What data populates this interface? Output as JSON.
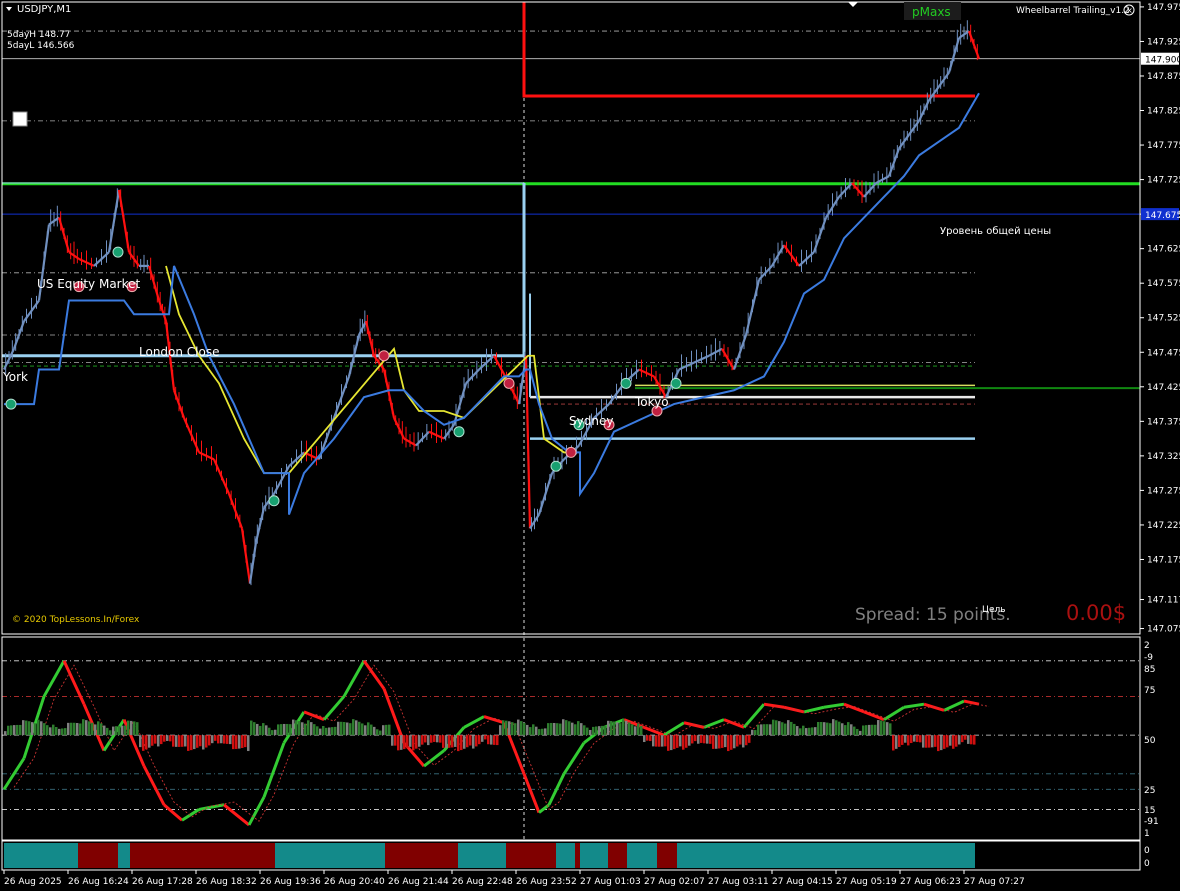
{
  "symbol": "USDJPY,M1",
  "info": {
    "five_day_high": "5dayH 148.77",
    "five_day_low": "5dayL 146.566"
  },
  "indicator_name": "Wheelbarrel Trailing_v1.2",
  "pmaxs_label": "pMaxs",
  "copyright": "© 2020 TopLessons.In/Forex",
  "spread_text": "Spread: 15 points.",
  "profit_text": "0.00$",
  "target_label": "Цель",
  "common_price_label": "Уровень общей цены",
  "sessions": {
    "us_equity": "US Equity Market",
    "london_close": "London Close",
    "new_york": "York",
    "sydney": "Sydney",
    "tokyo": "Tokyo"
  },
  "price_axis": {
    "ticks": [
      "147.975",
      "147.925",
      "147.875",
      "147.825",
      "147.775",
      "147.725",
      "147.675",
      "147.625",
      "147.575",
      "147.525",
      "147.475",
      "147.425",
      "147.375",
      "147.325",
      "147.275",
      "147.225",
      "147.175",
      "147.117",
      "147.075"
    ],
    "current_price_label": "147.900",
    "common_price_tag": "147.675"
  },
  "oscillator_axis": {
    "labels": [
      "2",
      "-9",
      "85",
      "75",
      "50",
      "25",
      "15",
      "-91",
      "1"
    ]
  },
  "bar_axis": {
    "labels": [
      "0",
      "0"
    ]
  },
  "time_axis": [
    "26 Aug 2025",
    "26 Aug 16:24",
    "26 Aug 17:28",
    "26 Aug 18:32",
    "26 Aug 19:36",
    "26 Aug 20:40",
    "26 Aug 21:44",
    "26 Aug 22:48",
    "26 Aug 23:52",
    "27 Aug 01:03",
    "27 Aug 02:07",
    "27 Aug 03:11",
    "27 Aug 04:15",
    "27 Aug 05:19",
    "27 Aug 06:23",
    "27 Aug 07:27"
  ],
  "colors": {
    "bull": "#7090c0",
    "bear": "#ff1010",
    "trail_line": "#3b7be0",
    "yellow": "#e6e632",
    "green_level": "#22dd22",
    "red_level": "#ff1010",
    "session_line": "#9ad0f0",
    "teal": "#138a8a",
    "maroon": "#800000"
  },
  "chart_data": {
    "type": "line",
    "x_categories": [
      "26 Aug 2025",
      "26 Aug 16:24",
      "26 Aug 17:28",
      "26 Aug 18:32",
      "26 Aug 19:36",
      "26 Aug 20:40",
      "26 Aug 21:44",
      "26 Aug 22:48",
      "26 Aug 23:52",
      "27 Aug 01:03",
      "27 Aug 02:07",
      "27 Aug 03:11",
      "27 Aug 04:15",
      "27 Aug 05:19",
      "27 Aug 06:23",
      "27 Aug 07:27"
    ],
    "ylim": [
      147.07,
      147.985
    ],
    "price": [
      [
        0,
        147.45
      ],
      [
        10,
        147.48
      ],
      [
        20,
        147.52
      ],
      [
        35,
        147.55
      ],
      [
        45,
        147.66
      ],
      [
        55,
        147.67
      ],
      [
        65,
        147.62
      ],
      [
        75,
        147.61
      ],
      [
        90,
        147.6
      ],
      [
        105,
        147.62
      ],
      [
        115,
        147.71
      ],
      [
        125,
        147.62
      ],
      [
        135,
        147.6
      ],
      [
        145,
        147.6
      ],
      [
        155,
        147.55
      ],
      [
        162,
        147.52
      ],
      [
        170,
        147.42
      ],
      [
        180,
        147.38
      ],
      [
        195,
        147.33
      ],
      [
        210,
        147.32
      ],
      [
        225,
        147.27
      ],
      [
        238,
        147.22
      ],
      [
        246,
        147.14
      ],
      [
        252,
        147.2
      ],
      [
        260,
        147.25
      ],
      [
        270,
        147.27
      ],
      [
        285,
        147.31
      ],
      [
        300,
        147.33
      ],
      [
        315,
        147.32
      ],
      [
        330,
        147.38
      ],
      [
        345,
        147.44
      ],
      [
        355,
        147.5
      ],
      [
        362,
        147.52
      ],
      [
        370,
        147.47
      ],
      [
        380,
        147.45
      ],
      [
        390,
        147.38
      ],
      [
        400,
        147.35
      ],
      [
        412,
        147.34
      ],
      [
        425,
        147.36
      ],
      [
        440,
        147.35
      ],
      [
        450,
        147.37
      ],
      [
        462,
        147.43
      ],
      [
        475,
        147.45
      ],
      [
        490,
        147.47
      ],
      [
        505,
        147.43
      ],
      [
        515,
        147.4
      ],
      [
        522,
        147.47
      ],
      [
        526,
        147.22
      ],
      [
        535,
        147.24
      ],
      [
        548,
        147.3
      ],
      [
        560,
        147.32
      ],
      [
        575,
        147.34
      ],
      [
        590,
        147.38
      ],
      [
        605,
        147.4
      ],
      [
        620,
        147.43
      ],
      [
        635,
        147.45
      ],
      [
        650,
        147.44
      ],
      [
        662,
        147.41
      ],
      [
        675,
        147.45
      ],
      [
        690,
        147.46
      ],
      [
        705,
        147.47
      ],
      [
        718,
        147.48
      ],
      [
        730,
        147.45
      ],
      [
        742,
        147.5
      ],
      [
        755,
        147.58
      ],
      [
        768,
        147.6
      ],
      [
        780,
        147.63
      ],
      [
        795,
        147.6
      ],
      [
        810,
        147.62
      ],
      [
        822,
        147.67
      ],
      [
        835,
        147.7
      ],
      [
        848,
        147.72
      ],
      [
        860,
        147.7
      ],
      [
        872,
        147.72
      ],
      [
        885,
        147.73
      ],
      [
        895,
        147.77
      ],
      [
        905,
        147.79
      ],
      [
        915,
        147.81
      ],
      [
        925,
        147.84
      ],
      [
        935,
        147.86
      ],
      [
        945,
        147.88
      ],
      [
        955,
        147.93
      ],
      [
        965,
        147.94
      ],
      [
        975,
        147.9
      ]
    ],
    "trail": [
      [
        0,
        147.4
      ],
      [
        30,
        147.4
      ],
      [
        35,
        147.45
      ],
      [
        55,
        147.45
      ],
      [
        65,
        147.55
      ],
      [
        120,
        147.55
      ],
      [
        130,
        147.53
      ],
      [
        165,
        147.53
      ],
      [
        170,
        147.6
      ],
      [
        190,
        147.53
      ],
      [
        205,
        147.47
      ],
      [
        230,
        147.4
      ],
      [
        260,
        147.3
      ],
      [
        285,
        147.3
      ],
      [
        285,
        147.24
      ],
      [
        300,
        147.3
      ],
      [
        330,
        147.35
      ],
      [
        360,
        147.41
      ],
      [
        385,
        147.42
      ],
      [
        400,
        147.42
      ],
      [
        420,
        147.39
      ],
      [
        440,
        147.37
      ],
      [
        460,
        147.38
      ],
      [
        480,
        147.41
      ],
      [
        500,
        147.44
      ],
      [
        515,
        147.44
      ],
      [
        522,
        147.45
      ],
      [
        526,
        147.45
      ],
      [
        535,
        147.4
      ],
      [
        548,
        147.35
      ],
      [
        565,
        147.33
      ],
      [
        576,
        147.33
      ],
      [
        576,
        147.27
      ],
      [
        590,
        147.3
      ],
      [
        610,
        147.36
      ],
      [
        640,
        147.38
      ],
      [
        670,
        147.4
      ],
      [
        700,
        147.41
      ],
      [
        730,
        147.42
      ],
      [
        760,
        147.44
      ],
      [
        780,
        147.49
      ],
      [
        800,
        147.56
      ],
      [
        820,
        147.58
      ],
      [
        840,
        147.64
      ],
      [
        860,
        147.67
      ],
      [
        880,
        147.7
      ],
      [
        900,
        147.73
      ],
      [
        915,
        147.76
      ],
      [
        935,
        147.78
      ],
      [
        955,
        147.8
      ],
      [
        975,
        147.85
      ]
    ],
    "level_lines": {
      "red_level": 147.846,
      "green_level": 147.719,
      "common_price": 147.675,
      "current": 147.9
    },
    "session_levels": {
      "us_equity": 147.56,
      "london_close": 147.47,
      "sydney": 147.41,
      "tokyo": 147.35
    },
    "oscillator": [
      [
        0,
        15
      ],
      [
        20,
        35
      ],
      [
        40,
        75
      ],
      [
        60,
        98
      ],
      [
        80,
        70
      ],
      [
        100,
        40
      ],
      [
        120,
        60
      ],
      [
        140,
        30
      ],
      [
        160,
        5
      ],
      [
        178,
        -5
      ],
      [
        195,
        2
      ],
      [
        220,
        5
      ],
      [
        245,
        -8
      ],
      [
        260,
        10
      ],
      [
        280,
        45
      ],
      [
        300,
        65
      ],
      [
        320,
        60
      ],
      [
        340,
        75
      ],
      [
        360,
        98
      ],
      [
        380,
        80
      ],
      [
        400,
        45
      ],
      [
        420,
        30
      ],
      [
        440,
        40
      ],
      [
        460,
        55
      ],
      [
        480,
        62
      ],
      [
        500,
        58
      ],
      [
        520,
        25
      ],
      [
        535,
        0
      ],
      [
        545,
        5
      ],
      [
        560,
        25
      ],
      [
        580,
        45
      ],
      [
        600,
        55
      ],
      [
        620,
        60
      ],
      [
        640,
        55
      ],
      [
        660,
        50
      ],
      [
        680,
        58
      ],
      [
        700,
        55
      ],
      [
        720,
        60
      ],
      [
        740,
        55
      ],
      [
        760,
        70
      ],
      [
        780,
        68
      ],
      [
        800,
        65
      ],
      [
        820,
        68
      ],
      [
        840,
        70
      ],
      [
        860,
        65
      ],
      [
        880,
        60
      ],
      [
        900,
        68
      ],
      [
        920,
        70
      ],
      [
        940,
        66
      ],
      [
        960,
        72
      ],
      [
        975,
        70
      ]
    ]
  }
}
